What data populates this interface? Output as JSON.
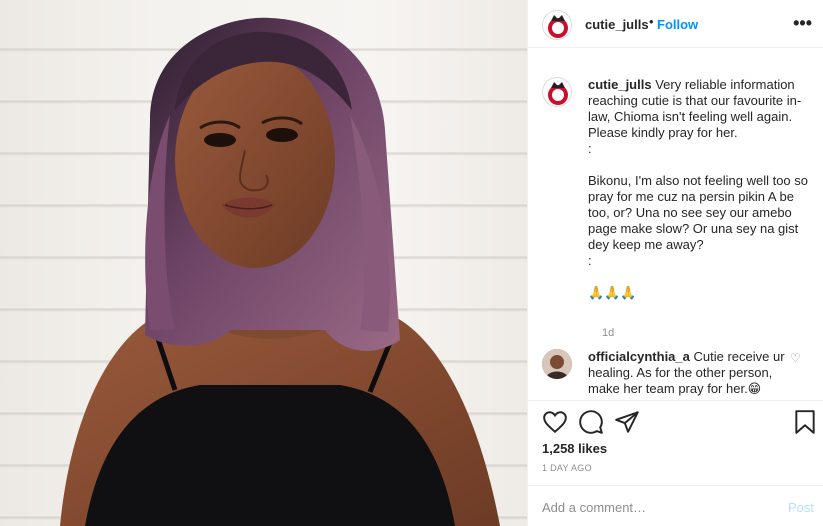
{
  "post": {
    "username": "cutie_julls",
    "follow_label": "Follow",
    "more_icon": "more-options-icon",
    "image_alt": "Portrait of a woman with a purple bob haircut wearing a black top"
  },
  "caption": {
    "username": "cutie_julls",
    "text": "Very reliable information reaching cutie is that our favourite in-law, Chioma isn't feeling well again. Please kindly pray for her.\n:\n\nBikonu, I'm also not feeling well too so pray for me cuz na persin pikin A be too, or? Una no see sey our amebo page make slow? Or una sey na gist dey keep me away?\n:\n\n🙏🙏🙏",
    "time": "1d"
  },
  "comment": {
    "username": "officialcynthia_a",
    "text": "Cutie receive ur healing. As for the other person, make her team pray for her.😁"
  },
  "actions": {
    "likes": "1,258 likes",
    "date": "1 DAY AGO"
  },
  "add_comment": {
    "placeholder": "Add a comment…",
    "post_label": "Post"
  },
  "colors": {
    "link": "#0095f6",
    "post_disabled": "#b2dffc",
    "muted": "#8e8e8e",
    "text": "#262626"
  }
}
